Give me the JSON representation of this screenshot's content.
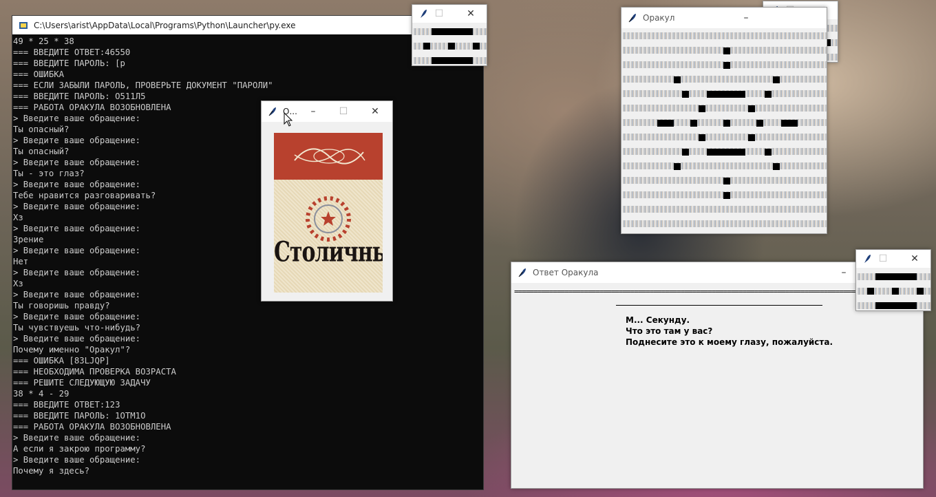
{
  "console": {
    "title": "C:\\Users\\arist\\AppData\\Local\\Programs\\Python\\Launcher\\py.exe",
    "lines": [
      "49 * 25 * 38",
      "=== ВВЕДИТЕ ОТВЕТ:46550",
      "=== ВВЕДИТЕ ПАРОЛЬ: [р",
      "=== ОШИБКА",
      "=== ЕСЛИ ЗАБЫЛИ ПАРОЛЬ, ПРОВЕРЬТЕ ДОКУМЕНТ \"ПАРОЛИ\"",
      "=== ВВЕДИТЕ ПАРОЛЬ: О511Л5",
      "=== РАБОТА ОРАКУЛА ВОЗОБНОВЛЕНА",
      "> Введите ваше обращение:",
      "Ты опасный?",
      "> Введите ваше обращение:",
      "Ты опасный?",
      "> Введите ваше обращение:",
      "Ты - это глаз?",
      "> Введите ваше обращение:",
      "Тебе нравится разговаривать?",
      "> Введите ваше обращение:",
      "Хз",
      "> Введите ваше обращение:",
      "Зрение",
      "> Введите ваше обращение:",
      "Нет",
      "> Введите ваше обращение:",
      "Хз",
      "> Введите ваше обращение:",
      "Ты говоришь правду?",
      "> Введите ваше обращение:",
      "Ты чувствуешь что-нибудь?",
      "> Введите ваше обращение:",
      "Почему именно \"Оракул\"?",
      "=== ОШИБКА [83LJQP]",
      "=== НЕОБХОДИМА ПРОВЕРКА ВОЗРАСТА",
      "=== РЕШИТЕ СЛЕДУЮЩУЮ ЗАДАЧУ",
      "38 * 4 - 29",
      "=== ВВЕДИТЕ ОТВЕТ:123",
      "=== ВВЕДИТЕ ПАРОЛЬ: 1ОТМ1О",
      "=== РАБОТА ОРАКУЛА ВОЗОБНОВЛЕНА",
      "> Введите ваше обращение:",
      "А если я закрою программу?",
      "> Введите ваше обращение:",
      "Почему я здесь?"
    ]
  },
  "image_window": {
    "title": "О...",
    "brand": "Столичные"
  },
  "oracle_window": {
    "title": "Оракул"
  },
  "answer_window": {
    "title": "Ответ Оракула",
    "separator": "================================================================================================================",
    "message_lines": [
      "М... Секунду.",
      "Что это там у вас?",
      "Поднесите это к моему глазу, пожалуйста."
    ]
  },
  "window_controls": {
    "minimize": "–",
    "maximize": "☐",
    "close": "✕"
  },
  "colors": {
    "console_bg": "#0c0c0c",
    "console_text": "#cccccc",
    "tk_bg": "#f0f0f0",
    "pack_red": "#b8412e"
  }
}
